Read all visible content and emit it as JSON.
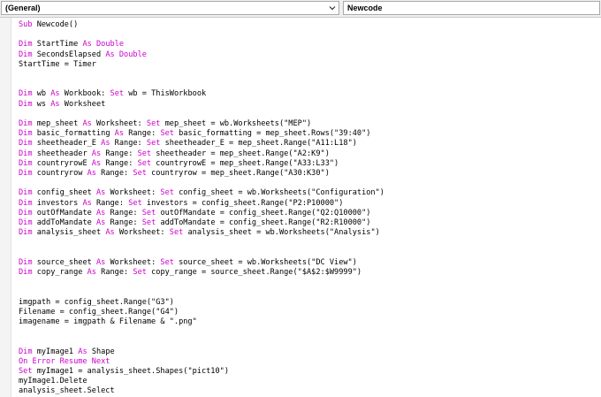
{
  "object_combo": {
    "value": "(General)"
  },
  "procedure_combo": {
    "value": "Newcode"
  },
  "colors": {
    "keyword": "#cc00cc",
    "text": "#000000",
    "background": "#ffffff"
  },
  "code_lines": [
    [
      [
        "kw",
        "Sub"
      ],
      [
        "t",
        " Newcode()"
      ]
    ],
    [],
    [
      [
        "kw",
        "Dim"
      ],
      [
        "t",
        " StartTime "
      ],
      [
        "kw",
        "As"
      ],
      [
        "t",
        " "
      ],
      [
        "kw",
        "Double"
      ]
    ],
    [
      [
        "kw",
        "Dim"
      ],
      [
        "t",
        " SecondsElapsed "
      ],
      [
        "kw",
        "As"
      ],
      [
        "t",
        " "
      ],
      [
        "kw",
        "Double"
      ]
    ],
    [
      [
        "t",
        "StartTime = Timer"
      ]
    ],
    [],
    [],
    [
      [
        "kw",
        "Dim"
      ],
      [
        "t",
        " wb "
      ],
      [
        "kw",
        "As"
      ],
      [
        "t",
        " Workbook: "
      ],
      [
        "kw",
        "Set"
      ],
      [
        "t",
        " wb = ThisWorkbook"
      ]
    ],
    [
      [
        "kw",
        "Dim"
      ],
      [
        "t",
        " ws "
      ],
      [
        "kw",
        "As"
      ],
      [
        "t",
        " Worksheet"
      ]
    ],
    [],
    [
      [
        "kw",
        "Dim"
      ],
      [
        "t",
        " mep_sheet "
      ],
      [
        "kw",
        "As"
      ],
      [
        "t",
        " Worksheet: "
      ],
      [
        "kw",
        "Set"
      ],
      [
        "t",
        " mep_sheet = wb.Worksheets(\"MEP\")"
      ]
    ],
    [
      [
        "kw",
        "Dim"
      ],
      [
        "t",
        " basic_formatting "
      ],
      [
        "kw",
        "As"
      ],
      [
        "t",
        " Range: "
      ],
      [
        "kw",
        "Set"
      ],
      [
        "t",
        " basic_formatting = mep_sheet.Rows(\"39:40\")"
      ]
    ],
    [
      [
        "kw",
        "Dim"
      ],
      [
        "t",
        " sheetheader_E "
      ],
      [
        "kw",
        "As"
      ],
      [
        "t",
        " Range: "
      ],
      [
        "kw",
        "Set"
      ],
      [
        "t",
        " sheetheader_E = mep_sheet.Range(\"A11:L18\")"
      ]
    ],
    [
      [
        "kw",
        "Dim"
      ],
      [
        "t",
        " sheetheader "
      ],
      [
        "kw",
        "As"
      ],
      [
        "t",
        " Range: "
      ],
      [
        "kw",
        "Set"
      ],
      [
        "t",
        " sheetheader = mep_sheet.Range(\"A2:K9\")"
      ]
    ],
    [
      [
        "kw",
        "Dim"
      ],
      [
        "t",
        " countryrowE "
      ],
      [
        "kw",
        "As"
      ],
      [
        "t",
        " Range: "
      ],
      [
        "kw",
        "Set"
      ],
      [
        "t",
        " countryrowE = mep_sheet.Range(\"A33:L33\")"
      ]
    ],
    [
      [
        "kw",
        "Dim"
      ],
      [
        "t",
        " countryrow "
      ],
      [
        "kw",
        "As"
      ],
      [
        "t",
        " Range: "
      ],
      [
        "kw",
        "Set"
      ],
      [
        "t",
        " countryrow = mep_sheet.Range(\"A30:K30\")"
      ]
    ],
    [],
    [
      [
        "kw",
        "Dim"
      ],
      [
        "t",
        " config_sheet "
      ],
      [
        "kw",
        "As"
      ],
      [
        "t",
        " Worksheet: "
      ],
      [
        "kw",
        "Set"
      ],
      [
        "t",
        " config_sheet = wb.Worksheets(\"Configuration\")"
      ]
    ],
    [
      [
        "kw",
        "Dim"
      ],
      [
        "t",
        " investors "
      ],
      [
        "kw",
        "As"
      ],
      [
        "t",
        " Range: "
      ],
      [
        "kw",
        "Set"
      ],
      [
        "t",
        " investors = config_sheet.Range(\"P2:P10000\")"
      ]
    ],
    [
      [
        "kw",
        "Dim"
      ],
      [
        "t",
        " outOfMandate "
      ],
      [
        "kw",
        "As"
      ],
      [
        "t",
        " Range: "
      ],
      [
        "kw",
        "Set"
      ],
      [
        "t",
        " outOfMandate = config_sheet.Range(\"Q2:Q10000\")"
      ]
    ],
    [
      [
        "kw",
        "Dim"
      ],
      [
        "t",
        " addToMandate "
      ],
      [
        "kw",
        "As"
      ],
      [
        "t",
        " Range: "
      ],
      [
        "kw",
        "Set"
      ],
      [
        "t",
        " addToMandate = config_sheet.Range(\"R2:R10000\")"
      ]
    ],
    [
      [
        "kw",
        "Dim"
      ],
      [
        "t",
        " analysis_sheet "
      ],
      [
        "kw",
        "As"
      ],
      [
        "t",
        " Worksheet: "
      ],
      [
        "kw",
        "Set"
      ],
      [
        "t",
        " analysis_sheet = wb.Worksheets(\"Analysis\")"
      ]
    ],
    [],
    [],
    [
      [
        "kw",
        "Dim"
      ],
      [
        "t",
        " source_sheet "
      ],
      [
        "kw",
        "As"
      ],
      [
        "t",
        " Worksheet: "
      ],
      [
        "kw",
        "Set"
      ],
      [
        "t",
        " source_sheet = wb.Worksheets(\"DC View\")"
      ]
    ],
    [
      [
        "kw",
        "Dim"
      ],
      [
        "t",
        " copy_range "
      ],
      [
        "kw",
        "As"
      ],
      [
        "t",
        " Range: "
      ],
      [
        "kw",
        "Set"
      ],
      [
        "t",
        " copy_range = source_sheet.Range(\"$A$2:$W9999\")"
      ]
    ],
    [],
    [],
    [
      [
        "t",
        "imgpath = config_sheet.Range(\"G3\")"
      ]
    ],
    [
      [
        "t",
        "Filename = config_sheet.Range(\"G4\")"
      ]
    ],
    [
      [
        "t",
        "imagename = imgpath & Filename & \".png\""
      ]
    ],
    [],
    [],
    [
      [
        "kw",
        "Dim"
      ],
      [
        "t",
        " myImage1 "
      ],
      [
        "kw",
        "As"
      ],
      [
        "t",
        " Shape"
      ]
    ],
    [
      [
        "kw",
        "On Error Resume Next"
      ]
    ],
    [
      [
        "kw",
        "Set"
      ],
      [
        "t",
        " myImage1 = analysis_sheet.Shapes(\"pict10\")"
      ]
    ],
    [
      [
        "t",
        "myImage1.Delete"
      ]
    ],
    [
      [
        "t",
        "analysis_sheet.Select"
      ]
    ]
  ]
}
